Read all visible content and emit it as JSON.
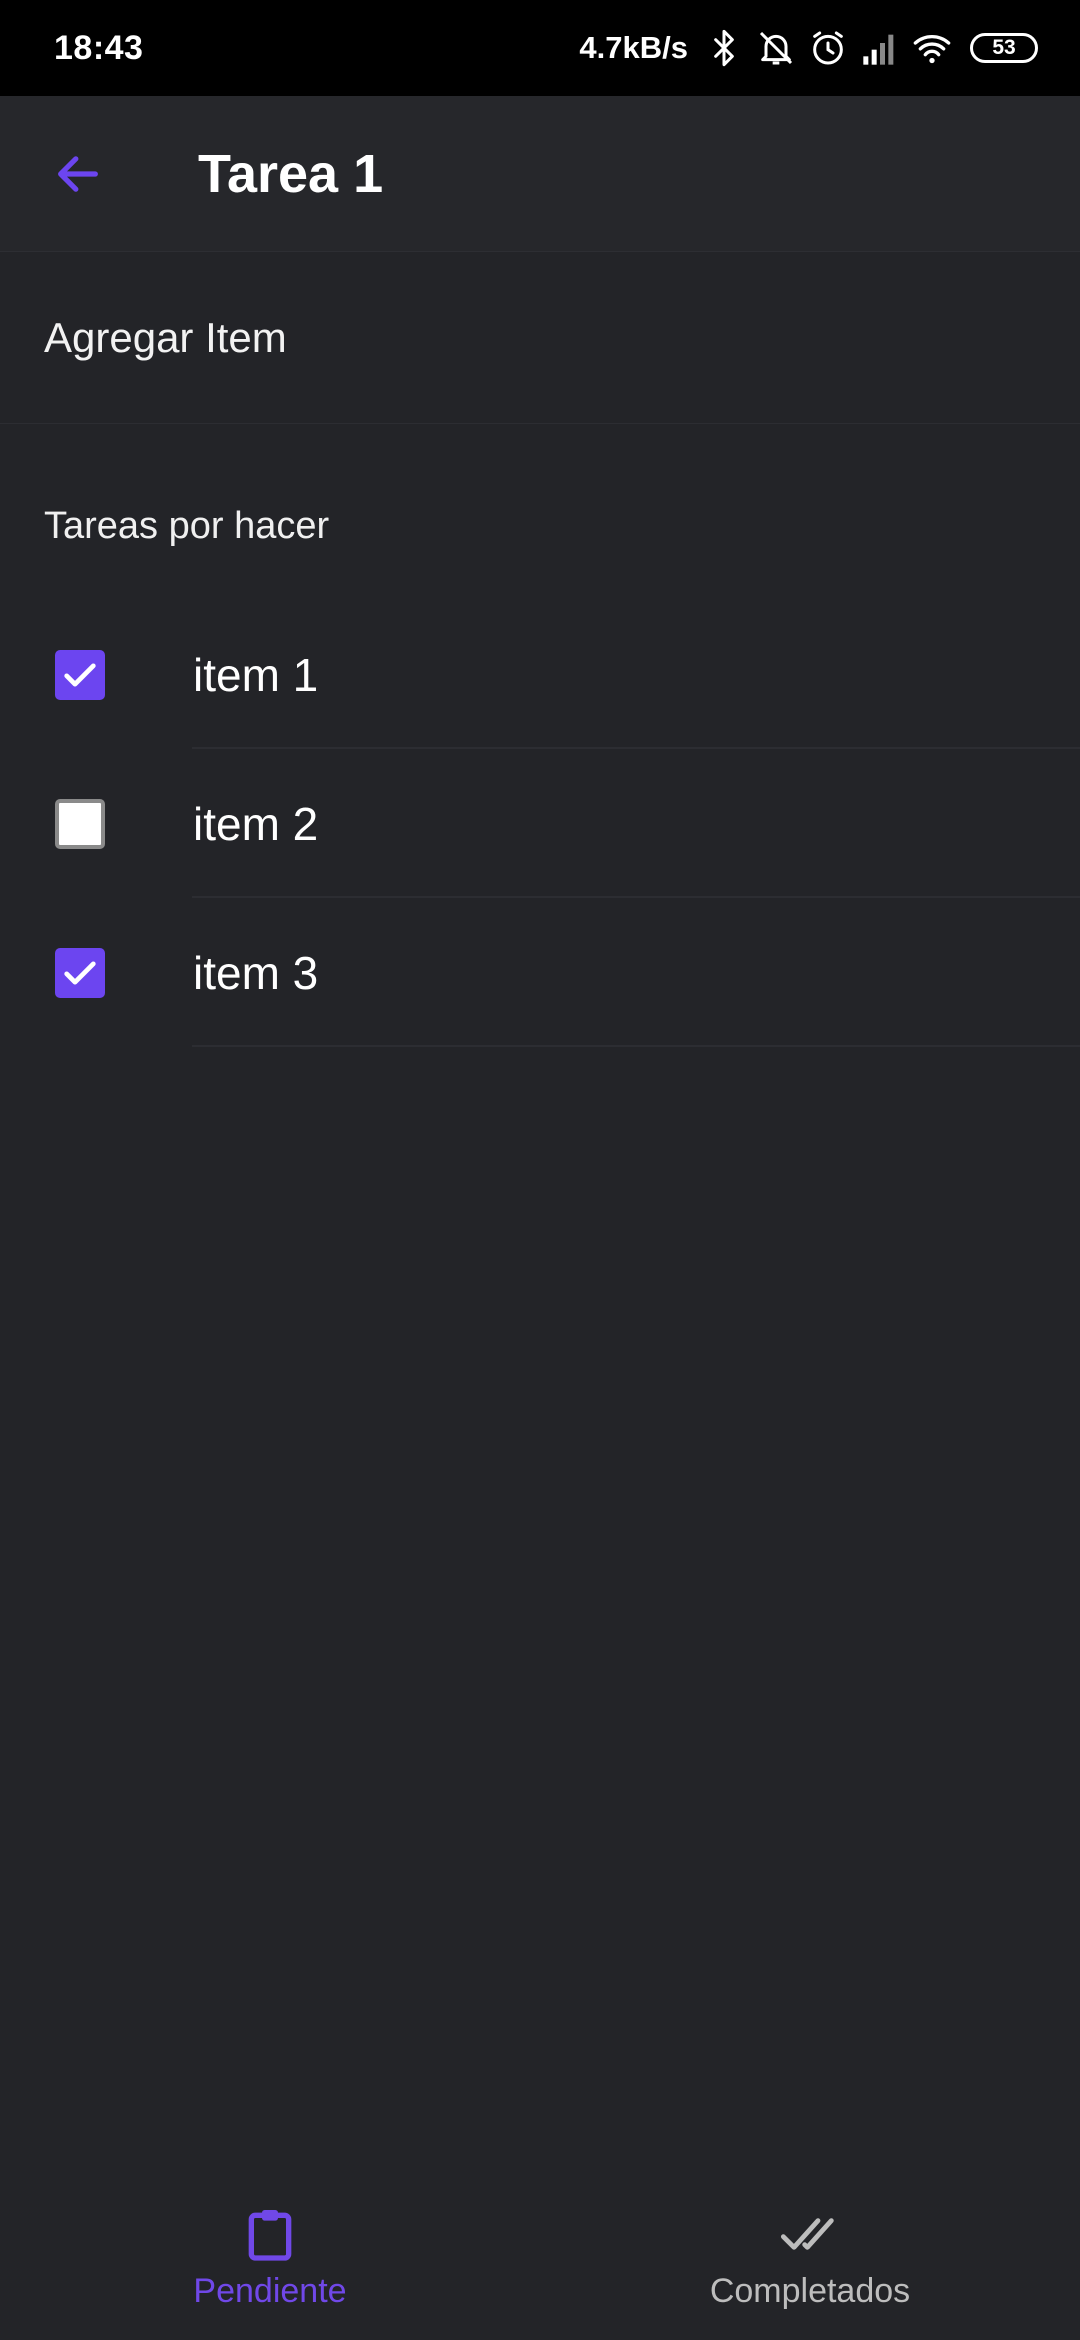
{
  "status_bar": {
    "time": "18:43",
    "network_speed": "4.7kB/s",
    "battery_level": "53",
    "icons": [
      "bluetooth-icon",
      "bell-off-icon",
      "alarm-icon",
      "signal-icon",
      "wifi-icon",
      "battery-icon"
    ]
  },
  "app_bar": {
    "title": "Tarea 1",
    "back_icon": "arrow-left-icon"
  },
  "add_item": {
    "label": "Agregar Item"
  },
  "section": {
    "title": "Tareas por hacer"
  },
  "tasks": [
    {
      "label": "item 1",
      "checked": true
    },
    {
      "label": "item 2",
      "checked": false
    },
    {
      "label": "item 3",
      "checked": true
    }
  ],
  "bottom_nav": {
    "items": [
      {
        "label": "Pendiente",
        "icon": "clipboard-icon",
        "active": true
      },
      {
        "label": "Completados",
        "icon": "double-check-icon",
        "active": false
      }
    ]
  },
  "colors": {
    "accent": "#6c45f0",
    "background": "#232428",
    "status_bar": "#000000",
    "inactive_text": "#bdbdbd"
  }
}
